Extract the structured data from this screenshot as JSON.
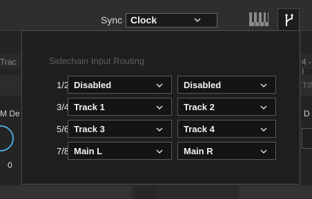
{
  "toolbar": {
    "sync_label": "Sync",
    "sync_value": "Clock"
  },
  "background": {
    "left_track_text": "Trac",
    "right_track_text": "4 - I",
    "left_mode_text": "M De",
    "right_ting_text": "TIN",
    "right_d_text": "D",
    "knob_value": "0"
  },
  "popup": {
    "title": "Sidechain Input Routing",
    "rows": [
      {
        "label": "1/2",
        "left": "Disabled",
        "right": "Disabled"
      },
      {
        "label": "3/4",
        "left": "Track 1",
        "right": "Track 2"
      },
      {
        "label": "5/6",
        "left": "Track 3",
        "right": "Track 4"
      },
      {
        "label": "7/8",
        "left": "Main L",
        "right": "Main R"
      }
    ]
  },
  "colors": {
    "accent_knob": "#4aa8e0",
    "panel_bg": "#1e1e1e",
    "dropdown_bg": "#141414"
  },
  "icons": {
    "dropdown": "chevron-down-icon",
    "piano": "piano-keyboard-icon",
    "routing": "routing-fork-icon"
  }
}
